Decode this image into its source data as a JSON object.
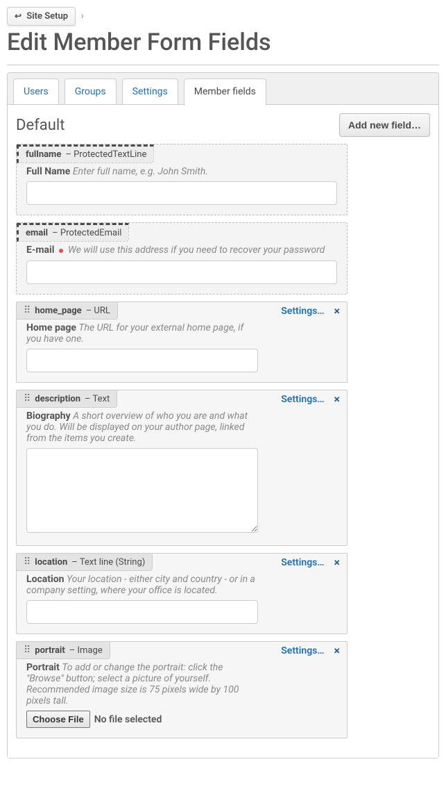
{
  "breadcrumb": {
    "site_setup": "Site Setup",
    "sep": "›"
  },
  "page_title": "Edit Member Form Fields",
  "tabs": [
    {
      "id": "users",
      "label": "Users",
      "active": false
    },
    {
      "id": "groups",
      "label": "Groups",
      "active": false
    },
    {
      "id": "settings",
      "label": "Settings",
      "active": false
    },
    {
      "id": "member-fields",
      "label": "Member fields",
      "active": true
    }
  ],
  "section": {
    "title": "Default",
    "add_label": "Add new field…"
  },
  "actions": {
    "settings": "Settings…",
    "close": "×",
    "file_button": "Choose File",
    "file_status": "No file selected"
  },
  "fields": [
    {
      "name": "fullname",
      "type": "ProtectedTextLine",
      "protected": true,
      "label": "Full Name",
      "required": false,
      "hint": "Enter full name, e.g. John Smith.",
      "widget": "text"
    },
    {
      "name": "email",
      "type": "ProtectedEmail",
      "protected": true,
      "label": "E-mail",
      "required": true,
      "hint": "We will use this address if you need to recover your password",
      "widget": "text"
    },
    {
      "name": "home_page",
      "type": "URL",
      "protected": false,
      "label": "Home page",
      "required": false,
      "hint": "The URL for your external home page, if you have one.",
      "widget": "text"
    },
    {
      "name": "description",
      "type": "Text",
      "protected": false,
      "label": "Biography",
      "required": false,
      "hint": "A short overview of who you are and what you do. Will be displayed on your author page, linked from the items you create.",
      "widget": "textarea"
    },
    {
      "name": "location",
      "type": "Text line (String)",
      "protected": false,
      "label": "Location",
      "required": false,
      "hint": "Your location - either city and country - or in a company setting, where your office is located.",
      "widget": "text"
    },
    {
      "name": "portrait",
      "type": "Image",
      "protected": false,
      "label": "Portrait",
      "required": false,
      "hint": "To add or change the portrait: click the \"Browse\" button; select a picture of yourself. Recommended image size is 75 pixels wide by 100 pixels tall.",
      "widget": "file"
    }
  ]
}
